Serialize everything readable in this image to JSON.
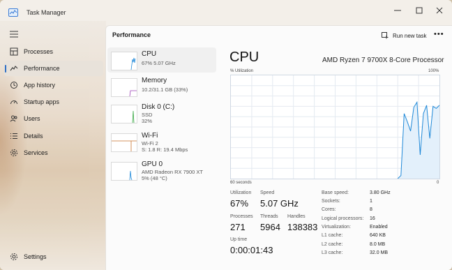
{
  "window": {
    "title": "Task Manager",
    "minimize": "—",
    "maximize": "☐",
    "close": "✕"
  },
  "sidebar": {
    "items": [
      {
        "label": "Processes"
      },
      {
        "label": "Performance"
      },
      {
        "label": "App history"
      },
      {
        "label": "Startup apps"
      },
      {
        "label": "Users"
      },
      {
        "label": "Details"
      },
      {
        "label": "Services"
      }
    ],
    "settings": "Settings"
  },
  "header": {
    "title": "Performance",
    "run_new_task": "Run new task",
    "more": "•••"
  },
  "devices": [
    {
      "name": "CPU",
      "line1": "67%  5.07 GHz"
    },
    {
      "name": "Memory",
      "line1": "10.2/31.1 GB (33%)"
    },
    {
      "name": "Disk 0 (C:)",
      "line1": "SSD",
      "line2": "32%"
    },
    {
      "name": "Wi-Fi",
      "line1": "Wi-Fi 2",
      "line2": "S: 1.8  R: 19.4 Mbps"
    },
    {
      "name": "GPU 0",
      "line1": "AMD Radeon RX 7900 XT",
      "line2": "5% (48 °C)"
    }
  ],
  "detail": {
    "title": "CPU",
    "processor": "AMD Ryzen 7 9700X 8-Core Processor",
    "graph": {
      "util_label": "% Utilization",
      "max_label": "100%",
      "time_label": "60 seconds",
      "zero_label": "0",
      "color": "#1e88d8",
      "utilization": [
        0,
        0,
        0,
        0,
        0,
        0,
        0,
        0,
        0,
        0,
        0,
        0,
        0,
        0,
        0,
        0,
        0,
        0,
        0,
        0,
        0,
        0,
        0,
        0,
        0,
        0,
        0,
        0,
        0,
        0,
        0,
        0,
        0,
        0,
        0,
        0,
        0,
        0,
        0,
        0,
        0,
        0,
        0,
        0,
        0,
        0,
        0,
        0,
        0,
        0,
        0,
        0,
        0,
        0.03,
        0.63,
        0.55,
        0.46,
        0.69,
        0.74,
        0.23,
        0.63,
        0.71,
        0.39,
        0.7,
        0.68,
        0.71
      ]
    },
    "stats": {
      "utilization_label": "Utilization",
      "utilization": "67%",
      "speed_label": "Speed",
      "speed": "5.07 GHz",
      "processes_label": "Processes",
      "processes": "271",
      "threads_label": "Threads",
      "threads": "5964",
      "handles_label": "Handles",
      "handles": "138383",
      "uptime_label": "Up time",
      "uptime": "0:00:01:43"
    },
    "specs": [
      {
        "key": "Base speed:",
        "value": "3.80 GHz"
      },
      {
        "key": "Sockets:",
        "value": "1"
      },
      {
        "key": "Cores:",
        "value": "8"
      },
      {
        "key": "Logical processors:",
        "value": "16"
      },
      {
        "key": "Virtualization:",
        "value": "Enabled"
      },
      {
        "key": "L1 cache:",
        "value": "640 KB"
      },
      {
        "key": "L2 cache:",
        "value": "8.0 MB"
      },
      {
        "key": "L3 cache:",
        "value": "32.0 MB"
      }
    ]
  }
}
